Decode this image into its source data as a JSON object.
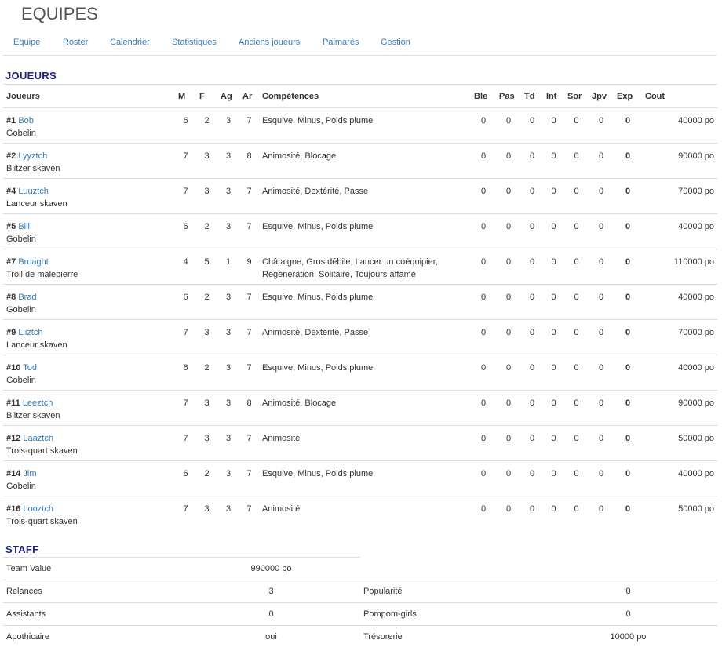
{
  "page": {
    "title": "EQUIPES"
  },
  "nav": [
    "Equipe",
    "Roster",
    "Calendrier",
    "Statistiques",
    "Anciens joueurs",
    "Palmarès",
    "Gestion"
  ],
  "players_section": {
    "title": "JOUEURS",
    "headers": [
      "Joueurs",
      "M",
      "F",
      "Ag",
      "Ar",
      "Compétences",
      "Ble",
      "Pas",
      "Td",
      "Int",
      "Sor",
      "Jpv",
      "Exp",
      "Cout"
    ],
    "rows": [
      {
        "num": "#1",
        "name": "Bob",
        "role": "Gobelin",
        "M": "6",
        "F": "2",
        "Ag": "3",
        "Ar": "7",
        "skills": "Esquive, Minus, Poids plume",
        "Ble": "0",
        "Pas": "0",
        "Td": "0",
        "Int": "0",
        "Sor": "0",
        "Jpv": "0",
        "Exp": "0",
        "Cout": "40000 po"
      },
      {
        "num": "#2",
        "name": "Lyyztch",
        "role": "Blitzer skaven",
        "M": "7",
        "F": "3",
        "Ag": "3",
        "Ar": "8",
        "skills": "Animosité, Blocage",
        "Ble": "0",
        "Pas": "0",
        "Td": "0",
        "Int": "0",
        "Sor": "0",
        "Jpv": "0",
        "Exp": "0",
        "Cout": "90000 po"
      },
      {
        "num": "#4",
        "name": "Luuztch",
        "role": "Lanceur skaven",
        "M": "7",
        "F": "3",
        "Ag": "3",
        "Ar": "7",
        "skills": "Animosité, Dextérité, Passe",
        "Ble": "0",
        "Pas": "0",
        "Td": "0",
        "Int": "0",
        "Sor": "0",
        "Jpv": "0",
        "Exp": "0",
        "Cout": "70000 po"
      },
      {
        "num": "#5",
        "name": "Bill",
        "role": "Gobelin",
        "M": "6",
        "F": "2",
        "Ag": "3",
        "Ar": "7",
        "skills": "Esquive, Minus, Poids plume",
        "Ble": "0",
        "Pas": "0",
        "Td": "0",
        "Int": "0",
        "Sor": "0",
        "Jpv": "0",
        "Exp": "0",
        "Cout": "40000 po"
      },
      {
        "num": "#7",
        "name": "Broaght",
        "role": "Troll de malepierre",
        "M": "4",
        "F": "5",
        "Ag": "1",
        "Ar": "9",
        "skills": "Châtaigne, Gros débile, Lancer un coéquipier, Régénération, Solitaire, Toujours affamé",
        "Ble": "0",
        "Pas": "0",
        "Td": "0",
        "Int": "0",
        "Sor": "0",
        "Jpv": "0",
        "Exp": "0",
        "Cout": "110000 po"
      },
      {
        "num": "#8",
        "name": "Brad",
        "role": "Gobelin",
        "M": "6",
        "F": "2",
        "Ag": "3",
        "Ar": "7",
        "skills": "Esquive, Minus, Poids plume",
        "Ble": "0",
        "Pas": "0",
        "Td": "0",
        "Int": "0",
        "Sor": "0",
        "Jpv": "0",
        "Exp": "0",
        "Cout": "40000 po"
      },
      {
        "num": "#9",
        "name": "Liiztch",
        "role": "Lanceur skaven",
        "M": "7",
        "F": "3",
        "Ag": "3",
        "Ar": "7",
        "skills": "Animosité, Dextérité, Passe",
        "Ble": "0",
        "Pas": "0",
        "Td": "0",
        "Int": "0",
        "Sor": "0",
        "Jpv": "0",
        "Exp": "0",
        "Cout": "70000 po"
      },
      {
        "num": "#10",
        "name": "Tod",
        "role": "Gobelin",
        "M": "6",
        "F": "2",
        "Ag": "3",
        "Ar": "7",
        "skills": "Esquive, Minus, Poids plume",
        "Ble": "0",
        "Pas": "0",
        "Td": "0",
        "Int": "0",
        "Sor": "0",
        "Jpv": "0",
        "Exp": "0",
        "Cout": "40000 po"
      },
      {
        "num": "#11",
        "name": "Leeztch",
        "role": "Blitzer skaven",
        "M": "7",
        "F": "3",
        "Ag": "3",
        "Ar": "8",
        "skills": "Animosité, Blocage",
        "Ble": "0",
        "Pas": "0",
        "Td": "0",
        "Int": "0",
        "Sor": "0",
        "Jpv": "0",
        "Exp": "0",
        "Cout": "90000 po"
      },
      {
        "num": "#12",
        "name": "Laaztch",
        "role": "Trois-quart skaven",
        "M": "7",
        "F": "3",
        "Ag": "3",
        "Ar": "7",
        "skills": "Animosité",
        "Ble": "0",
        "Pas": "0",
        "Td": "0",
        "Int": "0",
        "Sor": "0",
        "Jpv": "0",
        "Exp": "0",
        "Cout": "50000 po"
      },
      {
        "num": "#14",
        "name": "Jim",
        "role": "Gobelin",
        "M": "6",
        "F": "2",
        "Ag": "3",
        "Ar": "7",
        "skills": "Esquive, Minus, Poids plume",
        "Ble": "0",
        "Pas": "0",
        "Td": "0",
        "Int": "0",
        "Sor": "0",
        "Jpv": "0",
        "Exp": "0",
        "Cout": "40000 po"
      },
      {
        "num": "#16",
        "name": "Looztch",
        "role": "Trois-quart skaven",
        "M": "7",
        "F": "3",
        "Ag": "3",
        "Ar": "7",
        "skills": "Animosité",
        "Ble": "0",
        "Pas": "0",
        "Td": "0",
        "Int": "0",
        "Sor": "0",
        "Jpv": "0",
        "Exp": "0",
        "Cout": "50000 po"
      }
    ]
  },
  "staff": {
    "title": "STAFF",
    "team_value": {
      "label": "Team Value",
      "value": "990000 po"
    },
    "rows": [
      {
        "left_label": "Relances",
        "left_value": "3",
        "right_label": "Popularité",
        "right_value": "0"
      },
      {
        "left_label": "Assistants",
        "left_value": "0",
        "right_label": "Pompom-girls",
        "right_value": "0"
      },
      {
        "left_label": "Apothicaire",
        "left_value": "oui",
        "right_label": "Trésorerie",
        "right_value": "10000 po"
      }
    ]
  }
}
